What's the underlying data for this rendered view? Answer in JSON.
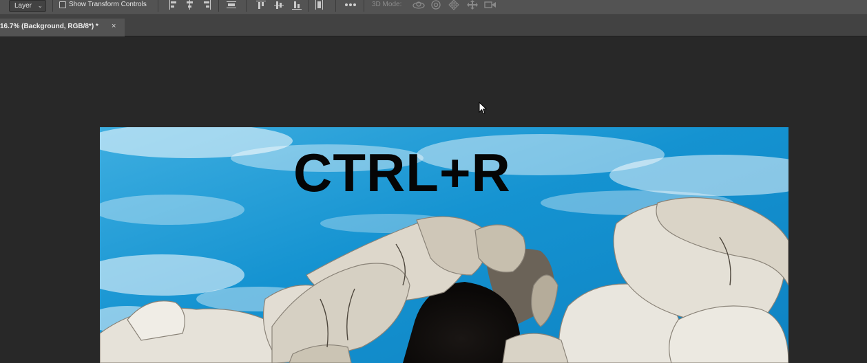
{
  "options_bar": {
    "layer_select_value": "Layer",
    "show_transform_label": "Show Transform Controls",
    "show_transform_checked": false,
    "mode_label": "3D Mode:",
    "icons": [
      "align-left-edges-icon",
      "align-horizontal-centers-icon",
      "align-right-edges-icon",
      "distribute-horizontal-icon",
      "align-top-edges-icon",
      "align-vertical-centers-icon",
      "align-bottom-edges-icon",
      "distribute-vertical-icon",
      "more-options-icon",
      "3d-orbit-icon",
      "3d-roll-icon",
      "3d-pan-icon",
      "3d-slide-icon",
      "3d-scale-icon"
    ]
  },
  "document_tab": {
    "title": "16.7% (Background, RGB/8*) *",
    "close_glyph": "×"
  },
  "canvas": {
    "text_layer": "CTRL+R"
  },
  "colors": {
    "options_bar": "#535353",
    "tab_bar": "#424242",
    "active_tab": "#535353",
    "workspace": "#282828",
    "sky": "#1d9ad6",
    "rock": "#e8e4dc"
  }
}
